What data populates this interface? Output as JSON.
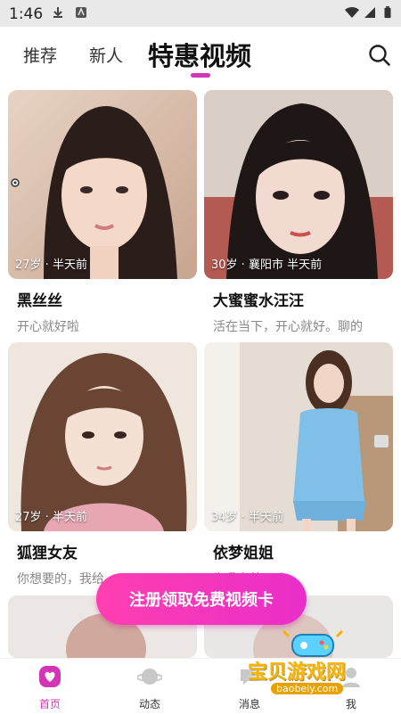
{
  "status_bar": {
    "time": "1:46"
  },
  "tabs": [
    {
      "label": "推荐"
    },
    {
      "label": "新人"
    },
    {
      "label": "特惠视频"
    }
  ],
  "cards": [
    {
      "meta": "27岁 · 半天前",
      "name": "黑丝丝",
      "bio": "开心就好啦"
    },
    {
      "meta": "30岁 · 襄阳市 半天前",
      "name": "大蜜蜜水汪汪",
      "bio": "活在当下，开心就好。聊的"
    },
    {
      "meta": "27岁 · 半天前",
      "name": "狐狸女友",
      "bio": "你想要的，我给"
    },
    {
      "meta": "34岁 · 半天前",
      "name": "依梦姐姐",
      "bio": "为我在等一个"
    }
  ],
  "cta": {
    "label": "注册领取免费视频卡"
  },
  "bottom_nav": [
    {
      "label": "首页",
      "icon": "home-icon",
      "active": true
    },
    {
      "label": "动态",
      "icon": "planet-icon",
      "active": false
    },
    {
      "label": "消息",
      "icon": "message-icon",
      "active": false
    },
    {
      "label": "我",
      "icon": "profile-icon",
      "active": false
    }
  ],
  "watermark": {
    "text": "宝贝游戏网",
    "url": "baobeiy.com"
  },
  "colors": {
    "accent": "#d335b6",
    "cta_start": "#ff3fb0",
    "cta_end": "#e92ec9"
  }
}
